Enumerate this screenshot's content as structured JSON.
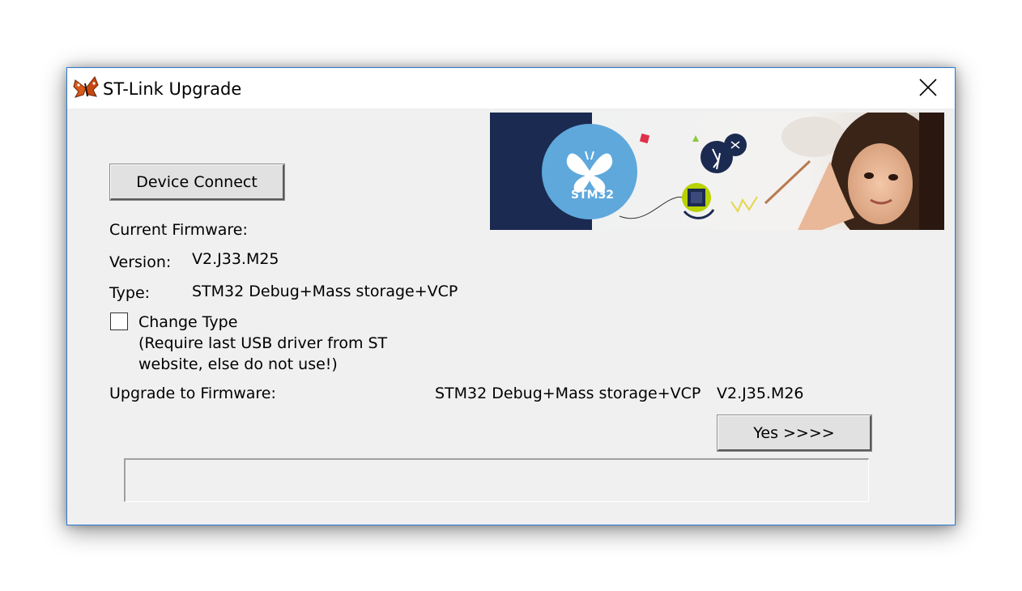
{
  "window": {
    "title": "ST-Link Upgrade"
  },
  "actions": {
    "connect_label": "Device Connect",
    "yes_label": "Yes >>>>"
  },
  "firmware": {
    "current_heading": "Current Firmware:",
    "version_label": "Version:",
    "version_value": "V2.J33.M25",
    "type_label": "Type:",
    "type_value": "STM32 Debug+Mass storage+VCP"
  },
  "change_type": {
    "label": "Change Type",
    "note_line1": "(Require last USB driver from ST",
    "note_line2": "website, else do not use!)",
    "checked": false
  },
  "upgrade": {
    "label": "Upgrade to Firmware:",
    "type_value": "STM32 Debug+Mass storage+VCP",
    "version_value": "V2.J35.M26"
  },
  "banner": {
    "logo_text": "STM32"
  },
  "progress": {
    "value": 0
  },
  "colors": {
    "window_border": "#2b79d0",
    "banner_navy": "#1b2a50",
    "banner_circle": "#5ea8dc"
  },
  "icons": {
    "app": "butterfly-icon",
    "close": "close-icon"
  }
}
